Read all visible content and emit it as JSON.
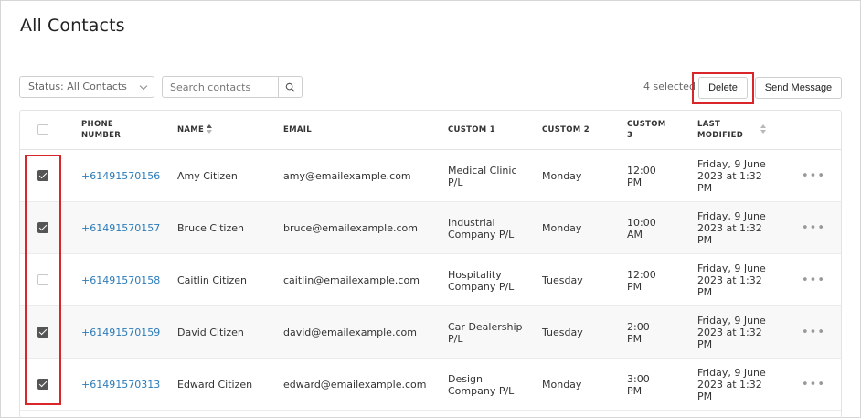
{
  "page": {
    "title": "All Contacts"
  },
  "toolbar": {
    "status_filter": "Status: All Contacts",
    "search_placeholder": "Search contacts",
    "selected_count": "4 selected",
    "delete_label": "Delete",
    "send_message_label": "Send Message"
  },
  "table": {
    "headers": {
      "phone": "PHONE NUMBER",
      "name": "NAME",
      "email": "EMAIL",
      "custom1": "CUSTOM 1",
      "custom2": "CUSTOM 2",
      "custom3": "CUSTOM 3",
      "last_modified": "LAST MODIFIED"
    },
    "rows": [
      {
        "checked": true,
        "phone": "+61491570156",
        "name": "Amy Citizen",
        "email": "amy@emailexample.com",
        "custom1": "Medical Clinic P/L",
        "custom2": "Monday",
        "custom3": "12:00 PM",
        "last_modified": "Friday, 9 June 2023 at 1:32 PM"
      },
      {
        "checked": true,
        "phone": "+61491570157",
        "name": "Bruce Citizen",
        "email": "bruce@emailexample.com",
        "custom1": "Industrial Company P/L",
        "custom2": "Monday",
        "custom3": "10:00 AM",
        "last_modified": "Friday, 9 June 2023 at 1:32 PM"
      },
      {
        "checked": false,
        "phone": "+61491570158",
        "name": "Caitlin Citizen",
        "email": "caitlin@emailexample.com",
        "custom1": "Hospitality Company P/L",
        "custom2": "Tuesday",
        "custom3": "12:00 PM",
        "last_modified": "Friday, 9 June 2023 at 1:32 PM"
      },
      {
        "checked": true,
        "phone": "+61491570159",
        "name": "David Citizen",
        "email": "david@emailexample.com",
        "custom1": "Car Dealership P/L",
        "custom2": "Tuesday",
        "custom3": "2:00 PM",
        "last_modified": "Friday, 9 June 2023 at 1:32 PM"
      },
      {
        "checked": true,
        "phone": "+61491570313",
        "name": "Edward Citizen",
        "email": "edward@emailexample.com",
        "custom1": "Design Company P/L",
        "custom2": "Monday",
        "custom3": "3:00 PM",
        "last_modified": "Friday, 9 June 2023 at 1:32 PM"
      }
    ]
  },
  "icons": {
    "search": "magnifier-icon",
    "chevron": "chevron-down-icon",
    "more": "more-horizontal-icon"
  },
  "colors": {
    "link": "#2b7bb8",
    "highlight": "#d8262b",
    "checkbox_checked": "#555555"
  }
}
